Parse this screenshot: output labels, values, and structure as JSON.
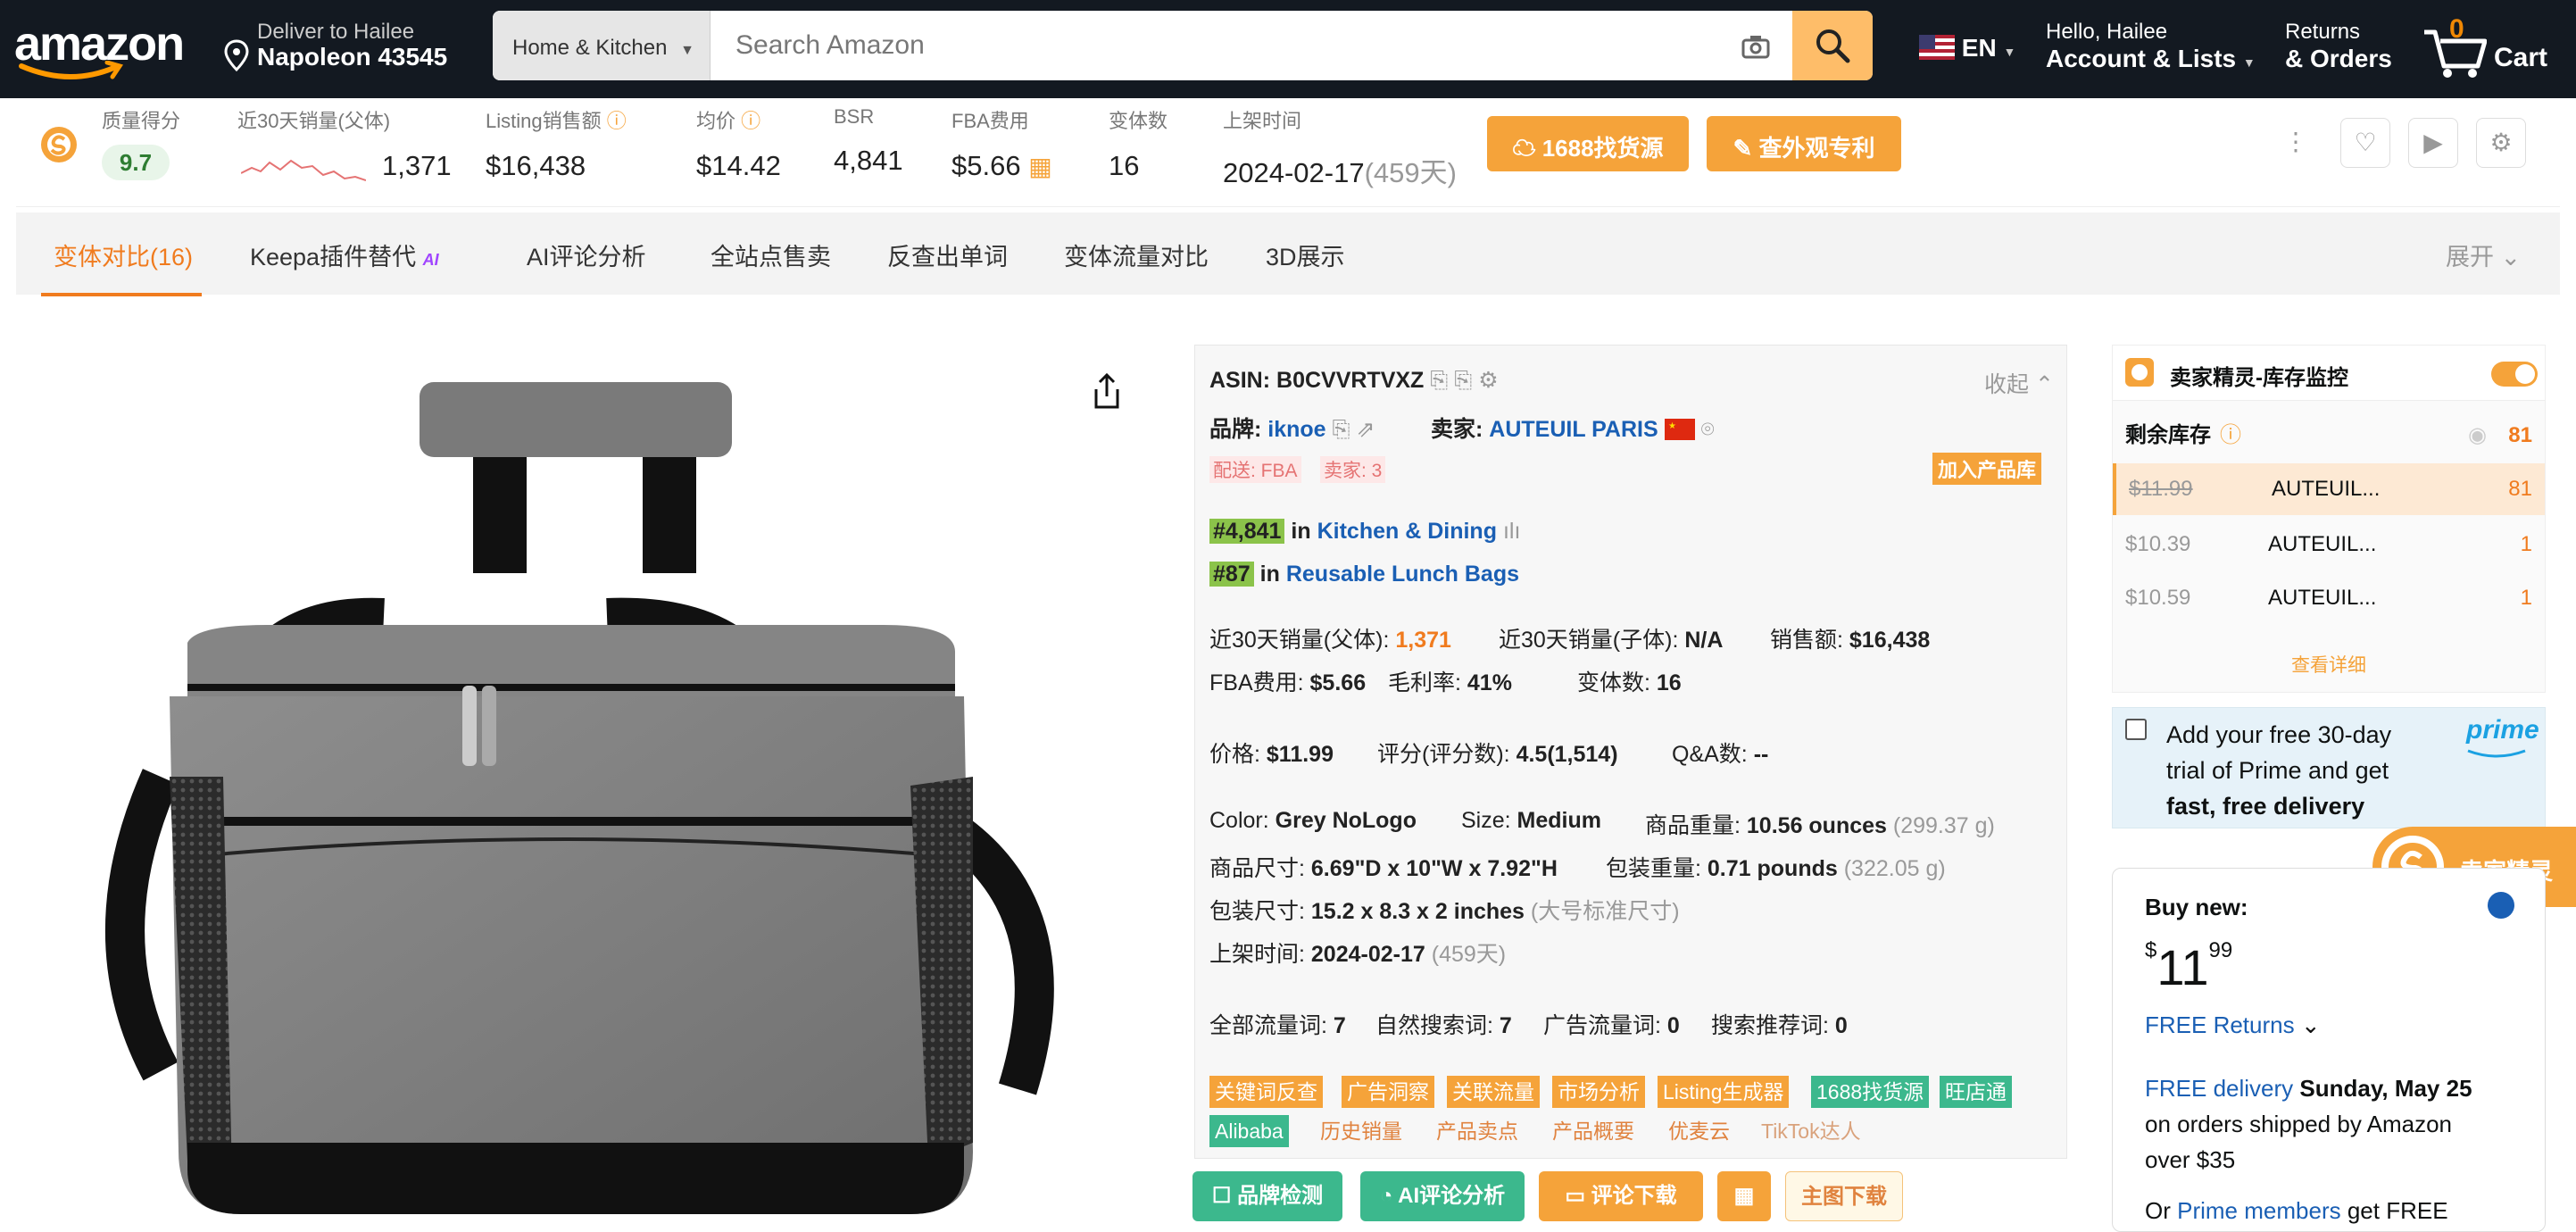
{
  "header": {
    "logo": "amazon",
    "deliver_line1": "Deliver to Hailee",
    "deliver_line2": "Napoleon 43545",
    "search_category": "Home & Kitchen",
    "search_placeholder": "Search Amazon",
    "lang": "EN",
    "account_line1": "Hello, Hailee",
    "account_line2": "Account & Lists",
    "orders_line1": "Returns",
    "orders_line2": "& Orders",
    "cart_count": "0",
    "cart_label": "Cart"
  },
  "metrics": {
    "quality_label": "质量得分",
    "quality_value": "9.7",
    "sales30_label": "近30天销量(父体)",
    "sales30_value": "1,371",
    "revenue_label": "Listing销售额",
    "revenue_value": "$16,438",
    "avgprice_label": "均价",
    "avgprice_value": "$14.42",
    "bsr_label": "BSR",
    "bsr_value": "4,841",
    "fba_label": "FBA费用",
    "fba_value": "$5.66",
    "variants_label": "变体数",
    "variants_value": "16",
    "listed_label": "上架时间",
    "listed_value": "2024-02-17",
    "listed_days": "(459天)",
    "btn_1688": "1688找货源",
    "btn_patent": "查外观专利"
  },
  "tabs": {
    "t1": "变体对比(16)",
    "t2": "Keepa插件替代",
    "t2_badge": "AI",
    "t3": "AI评论分析",
    "t4": "全站点售卖",
    "t5": "反查出单词",
    "t6": "变体流量对比",
    "t7": "3D展示",
    "expand": "展开"
  },
  "info": {
    "asin_label": "ASIN:",
    "asin": "B0CVVRTVXZ",
    "collapse": "收起",
    "brand_label": "品牌:",
    "brand": "iknoe",
    "seller_label": "卖家:",
    "seller": "AUTEUIL PARIS",
    "ship_tag": "配送: FBA",
    "sellers_tag": "卖家: 3",
    "add_lib": "加入产品库",
    "rank1": "#4,841",
    "rank1_in": "in",
    "rank1_cat": "Kitchen & Dining",
    "rank2": "#87",
    "rank2_in": "in",
    "rank2_cat": "Reusable Lunch Bags",
    "parent_sales_label": "近30天销量(父体):",
    "parent_sales": "1,371",
    "child_sales_label": "近30天销量(子体):",
    "child_sales": "N/A",
    "revenue_label": "销售额:",
    "revenue": "$16,438",
    "fba_label": "FBA费用:",
    "fba": "$5.66",
    "margin_label": "毛利率:",
    "margin": "41%",
    "variants_label": "变体数:",
    "variants": "16",
    "price_label": "价格:",
    "price": "$11.99",
    "rating_label": "评分(评分数):",
    "rating": "4.5(1,514)",
    "qa_label": "Q&A数:",
    "qa": "--",
    "color_label": "Color:",
    "color": "Grey NoLogo",
    "size_label": "Size:",
    "size": "Medium",
    "weight_label": "商品重量:",
    "weight": "10.56 ounces",
    "weight_g": "(299.37 g)",
    "dims_label": "商品尺寸:",
    "dims": "6.69\"D x 10\"W x 7.92\"H",
    "pkg_weight_label": "包装重量:",
    "pkg_weight": "0.71 pounds",
    "pkg_weight_g": "(322.05 g)",
    "pkg_dims_label": "包装尺寸:",
    "pkg_dims": "15.2 x 8.3 x 2 inches",
    "pkg_dims_note": "(大号标准尺寸)",
    "listed_label": "上架时间:",
    "listed": "2024-02-17",
    "listed_days": "(459天)",
    "kw_all_label": "全部流量词:",
    "kw_all": "7",
    "kw_organic_label": "自然搜索词:",
    "kw_organic": "7",
    "kw_ad_label": "广告流量词:",
    "kw_ad": "0",
    "kw_rec_label": "搜索推荐词:",
    "kw_rec": "0",
    "tags_row1": [
      "关键词反查",
      "广告洞察",
      "关联流量",
      "市场分析",
      "Listing生成器",
      "1688找货源",
      "旺店通"
    ],
    "tags_row2_green": "Alibaba",
    "tags_row2": [
      "历史销量",
      "产品卖点",
      "产品概要",
      "优麦云",
      "TikTok达人"
    ],
    "btn_brand": "品牌检测",
    "btn_ai": "AI评论分析",
    "btn_reviews": "评论下载",
    "btn_images": "主图下载"
  },
  "stock": {
    "title": "卖家精灵-库存监控",
    "remain_label": "剩余库存",
    "remain_total": "81",
    "rows": [
      {
        "price": "$11.99",
        "seller": "AUTEUIL...",
        "qty": "81"
      },
      {
        "price": "$10.39",
        "seller": "AUTEUIL...",
        "qty": "1"
      },
      {
        "price": "$10.59",
        "seller": "AUTEUIL...",
        "qty": "1"
      }
    ],
    "details": "查看详细"
  },
  "prime": {
    "line1": "Add your free 30-day",
    "line2": "trial of Prime and get",
    "line3": "fast, free delivery",
    "logo": "prime"
  },
  "float_badge": "卖家精灵",
  "buybox": {
    "buy_new": "Buy new:",
    "currency": "$",
    "dollars": "11",
    "cents": "99",
    "returns": "FREE Returns",
    "free_delivery": "FREE delivery",
    "delivery_date": "Sunday, May 25",
    "orders_line1": "on orders shipped by Amazon",
    "orders_line2": "over $35",
    "or": "Or",
    "prime_members": "Prime members",
    "get_free": "get FREE"
  },
  "colors": {
    "amazon_dark": "#131921",
    "search_btn": "#febd69",
    "orange": "#f5a33a",
    "green_tag": "#3cb88d",
    "link_blue": "#1a5fb4"
  }
}
